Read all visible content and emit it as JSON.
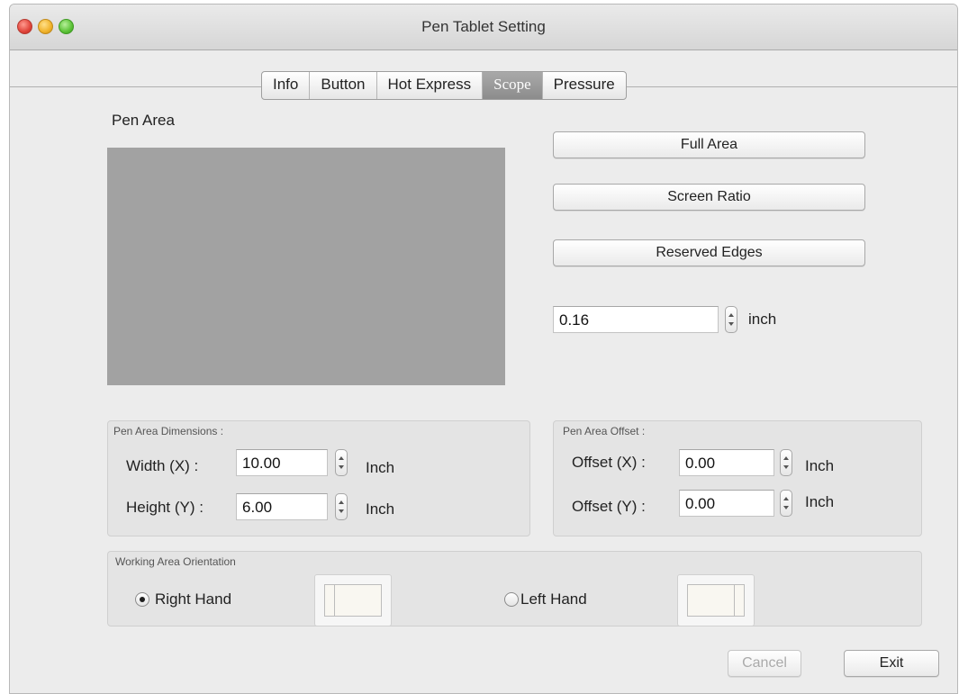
{
  "window": {
    "title": "Pen Tablet Setting"
  },
  "tabs": [
    {
      "label": "Info",
      "active": false
    },
    {
      "label": "Button",
      "active": false
    },
    {
      "label": "Hot Express",
      "active": false
    },
    {
      "label": "Scope",
      "active": true
    },
    {
      "label": "Pressure",
      "active": false
    }
  ],
  "pen_area": {
    "label": "Pen Area",
    "buttons": {
      "full_area": "Full Area",
      "screen_ratio": "Screen Ratio",
      "reserved_edges": "Reserved Edges"
    },
    "edge_value": "0.16",
    "edge_unit": "inch"
  },
  "dimensions": {
    "title": "Pen Area Dimensions :",
    "width_label": "Width (X) :",
    "width_value": "10.00",
    "height_label": "Height (Y) :",
    "height_value": "6.00",
    "unit": "Inch"
  },
  "offset": {
    "title": "Pen Area Offset :",
    "x_label": "Offset (X) :",
    "x_value": "0.00",
    "y_label": "Offset (Y) :",
    "y_value": "0.00",
    "unit": "Inch"
  },
  "orientation": {
    "title": "Working Area Orientation",
    "right_hand": "Right Hand",
    "left_hand": "Left Hand",
    "selected": "Right Hand"
  },
  "footer": {
    "cancel": "Cancel",
    "exit": "Exit"
  },
  "colors": {
    "active_tab": "#9a9a9a",
    "preview_area": "#a2a2a2"
  }
}
